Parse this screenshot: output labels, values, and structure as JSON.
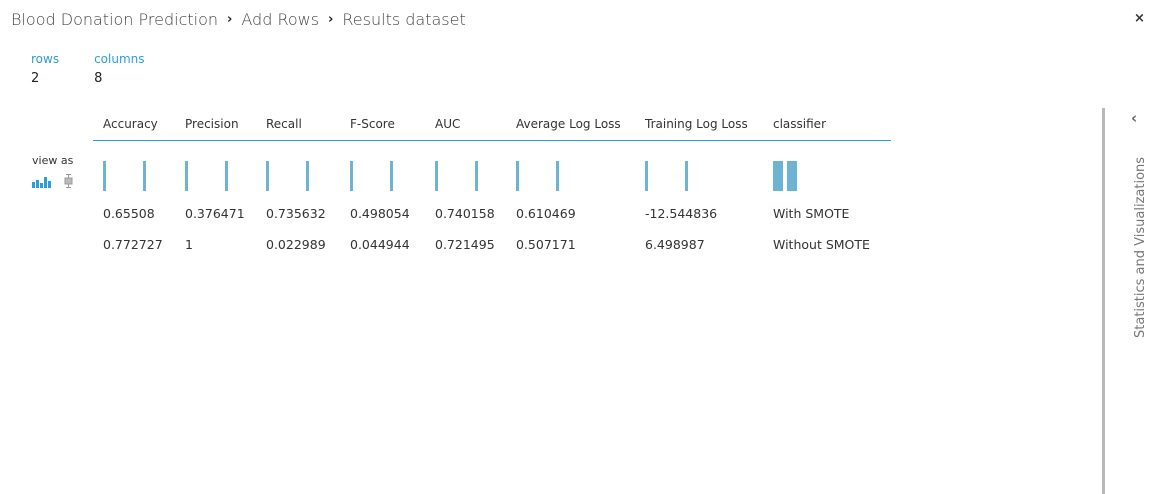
{
  "breadcrumb": {
    "items": [
      "Blood Donation Prediction",
      "Add Rows",
      "Results dataset"
    ],
    "separator": "›"
  },
  "close_icon": "×",
  "summary": {
    "rows_label": "rows",
    "rows_value": "2",
    "columns_label": "columns",
    "columns_value": "8"
  },
  "view_as": {
    "label": "view as",
    "icons": [
      "histogram-icon",
      "boxplot-icon"
    ]
  },
  "table": {
    "columns": [
      "Accuracy",
      "Precision",
      "Recall",
      "F-Score",
      "AUC",
      "Average Log Loss",
      "Training Log Loss",
      "classifier"
    ],
    "rows": [
      [
        "0.65508",
        "0.376471",
        "0.735632",
        "0.498054",
        "0.740158",
        "0.610469",
        "-12.544836",
        "With SMOTE"
      ],
      [
        "0.772727",
        "1",
        "0.022989",
        "0.044944",
        "0.721495",
        "0.507171",
        "6.498987",
        "Without SMOTE"
      ]
    ]
  },
  "side_panel": {
    "title": "Statistics and Visualizations",
    "chevron_icon": "chevron-left-icon"
  },
  "colors": {
    "accent": "#2a9fd6",
    "histogram_bar": "#6db3d2"
  }
}
